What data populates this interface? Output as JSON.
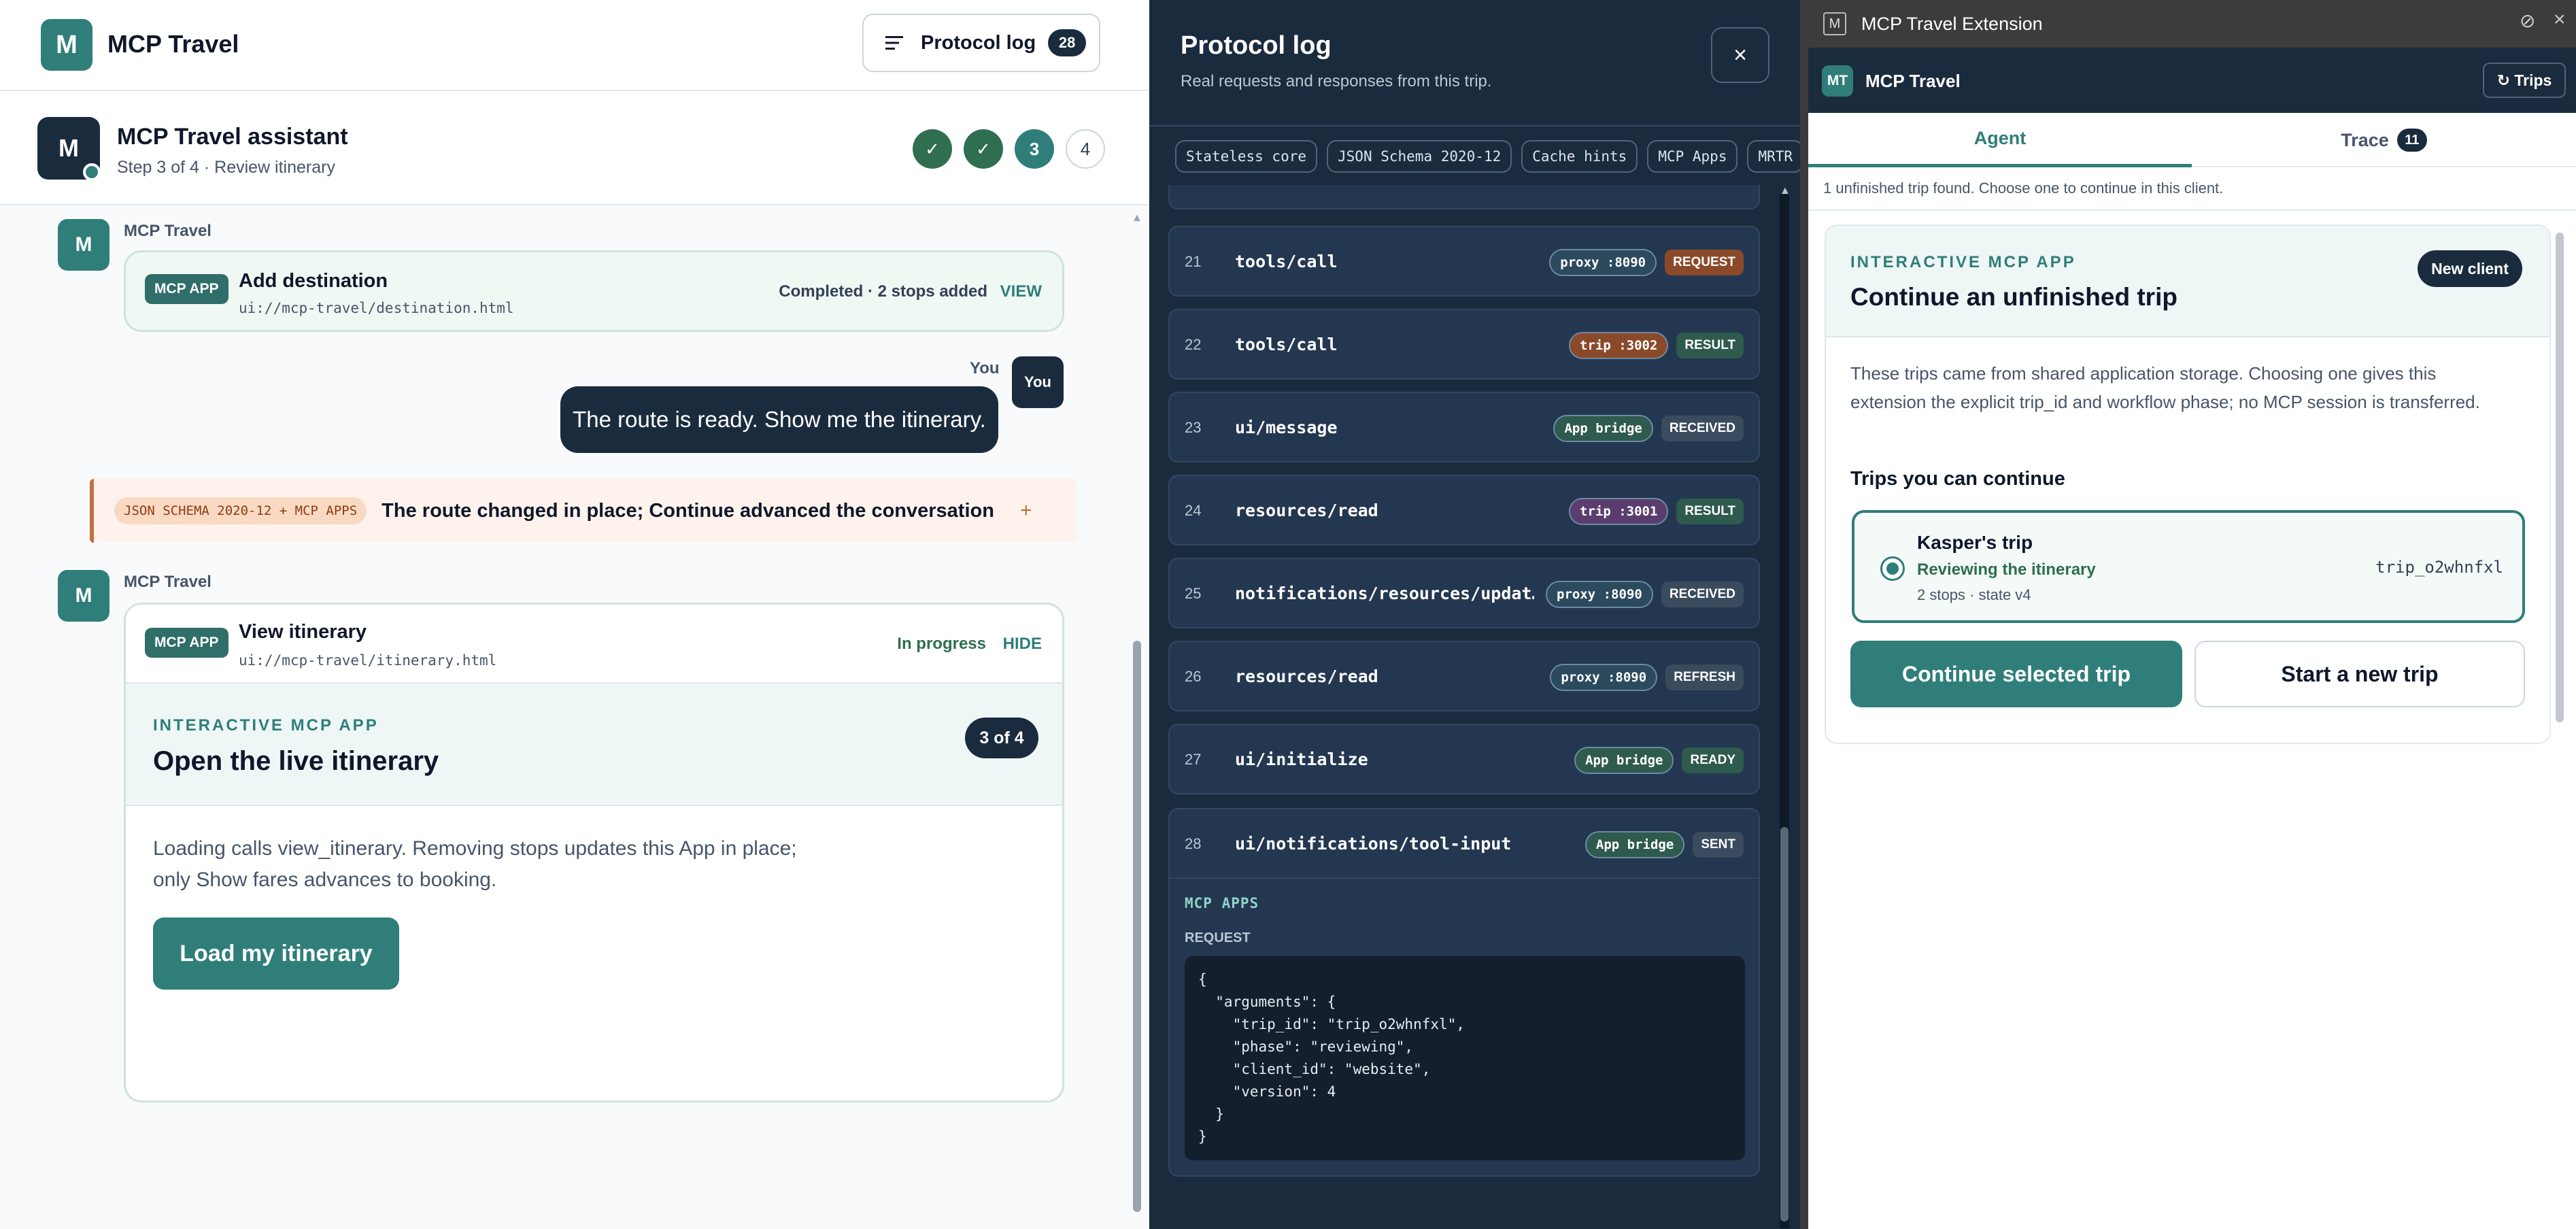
{
  "app": {
    "logo_letter": "M",
    "title": "MCP Travel",
    "protocol_btn": "Protocol log",
    "protocol_count": "28"
  },
  "assistant": {
    "avatar": "M",
    "title": "MCP Travel assistant",
    "subtitle": "Step 3 of 4 · Review itinerary",
    "steps": [
      "✓",
      "✓",
      "3",
      "4"
    ]
  },
  "chat": {
    "m1": {
      "avatar": "M",
      "sender": "MCP Travel",
      "badge": "MCP APP",
      "title": "Add destination",
      "uri": "ui://mcp-travel/destination.html",
      "status": "Completed · 2 stops added",
      "action": "VIEW"
    },
    "user": {
      "sender": "You",
      "avatar": "You",
      "text": "The route is ready. Show me the itinerary."
    },
    "note": {
      "tag": "JSON SCHEMA 2020-12 + MCP APPS",
      "text": "The route changed in place; Continue advanced the conversation",
      "plus": "+"
    },
    "m2": {
      "avatar": "M",
      "sender": "MCP Travel",
      "badge": "MCP APP",
      "title": "View itinerary",
      "uri": "ui://mcp-travel/itinerary.html",
      "status": "In progress",
      "action": "HIDE",
      "kicker": "INTERACTIVE MCP APP",
      "heading": "Open the live itinerary",
      "step": "3 of 4",
      "body": "Loading calls view_itinerary. Removing stops updates this App in place; only Show fares advances to booking.",
      "button": "Load my itinerary"
    }
  },
  "log": {
    "title": "Protocol log",
    "subtitle": "Real requests and responses from this trip.",
    "close": "×",
    "chips": [
      "Stateless core",
      "JSON Schema 2020-12",
      "Cache hints",
      "MCP Apps",
      "MRTR"
    ],
    "rows": [
      {
        "n": "21",
        "method": "tools/call",
        "src": "proxy :8090",
        "kind": "REQUEST",
        "srcColor": "#2b4a5e",
        "kindColor": "#8a4a2a"
      },
      {
        "n": "22",
        "method": "tools/call",
        "src": "trip :3002",
        "kind": "RESULT",
        "srcColor": "#8a4a2a",
        "kindColor": "#2f5a4e"
      },
      {
        "n": "23",
        "method": "ui/message",
        "src": "App bridge",
        "kind": "RECEIVED",
        "srcColor": "#2f5a4e",
        "kindColor": "#3a4b5e"
      },
      {
        "n": "24",
        "method": "resources/read",
        "src": "trip :3001",
        "kind": "RESULT",
        "srcColor": "#5a3d6e",
        "kindColor": "#2f5a4e"
      },
      {
        "n": "25",
        "method": "notifications/resources/updat…",
        "src": "proxy :8090",
        "kind": "RECEIVED",
        "srcColor": "#2b4a5e",
        "kindColor": "#3a4b5e"
      },
      {
        "n": "26",
        "method": "resources/read",
        "src": "proxy :8090",
        "kind": "REFRESH",
        "srcColor": "#2b4a5e",
        "kindColor": "#3a4b5e"
      },
      {
        "n": "27",
        "method": "ui/initialize",
        "src": "App bridge",
        "kind": "READY",
        "srcColor": "#2f5a4e",
        "kindColor": "#2f5a4e"
      },
      {
        "n": "28",
        "method": "ui/notifications/tool-input",
        "src": "App bridge",
        "kind": "SENT",
        "srcColor": "#2f5a4e",
        "kindColor": "#3a4b5e"
      }
    ],
    "detail": {
      "section": "MCP APPS",
      "label": "REQUEST",
      "code": [
        "{",
        "  \"arguments\": {",
        "    \"trip_id\": \"trip_o2whnfxl\",",
        "    \"phase\": \"reviewing\",",
        "    \"client_id\": \"website\",",
        "    \"version\": 4",
        "  }",
        "}"
      ]
    }
  },
  "ext": {
    "window_title": "MCP Travel Extension",
    "logo": "MT",
    "name": "MCP Travel",
    "trips_btn": "↻ Trips",
    "tabs": {
      "agent": "Agent",
      "trace": "Trace",
      "trace_count": "11"
    },
    "notice": "1 unfinished trip found. Choose one to continue in this client.",
    "card": {
      "kicker": "INTERACTIVE MCP APP",
      "badge": "New client",
      "heading": "Continue an unfinished trip",
      "body": "These trips came from shared application storage. Choosing one gives this extension the explicit trip_id and workflow phase; no MCP session is transferred.",
      "section": "Trips you can continue",
      "trip": {
        "name": "Kasper's trip",
        "status": "Reviewing the itinerary",
        "meta": "2 stops · state v4",
        "id": "trip_o2whnfxl"
      },
      "continue_btn": "Continue selected trip",
      "new_btn": "Start a new trip"
    }
  },
  "colors": {
    "teal": "#2f7e79",
    "navy": "#1b2b3e"
  }
}
